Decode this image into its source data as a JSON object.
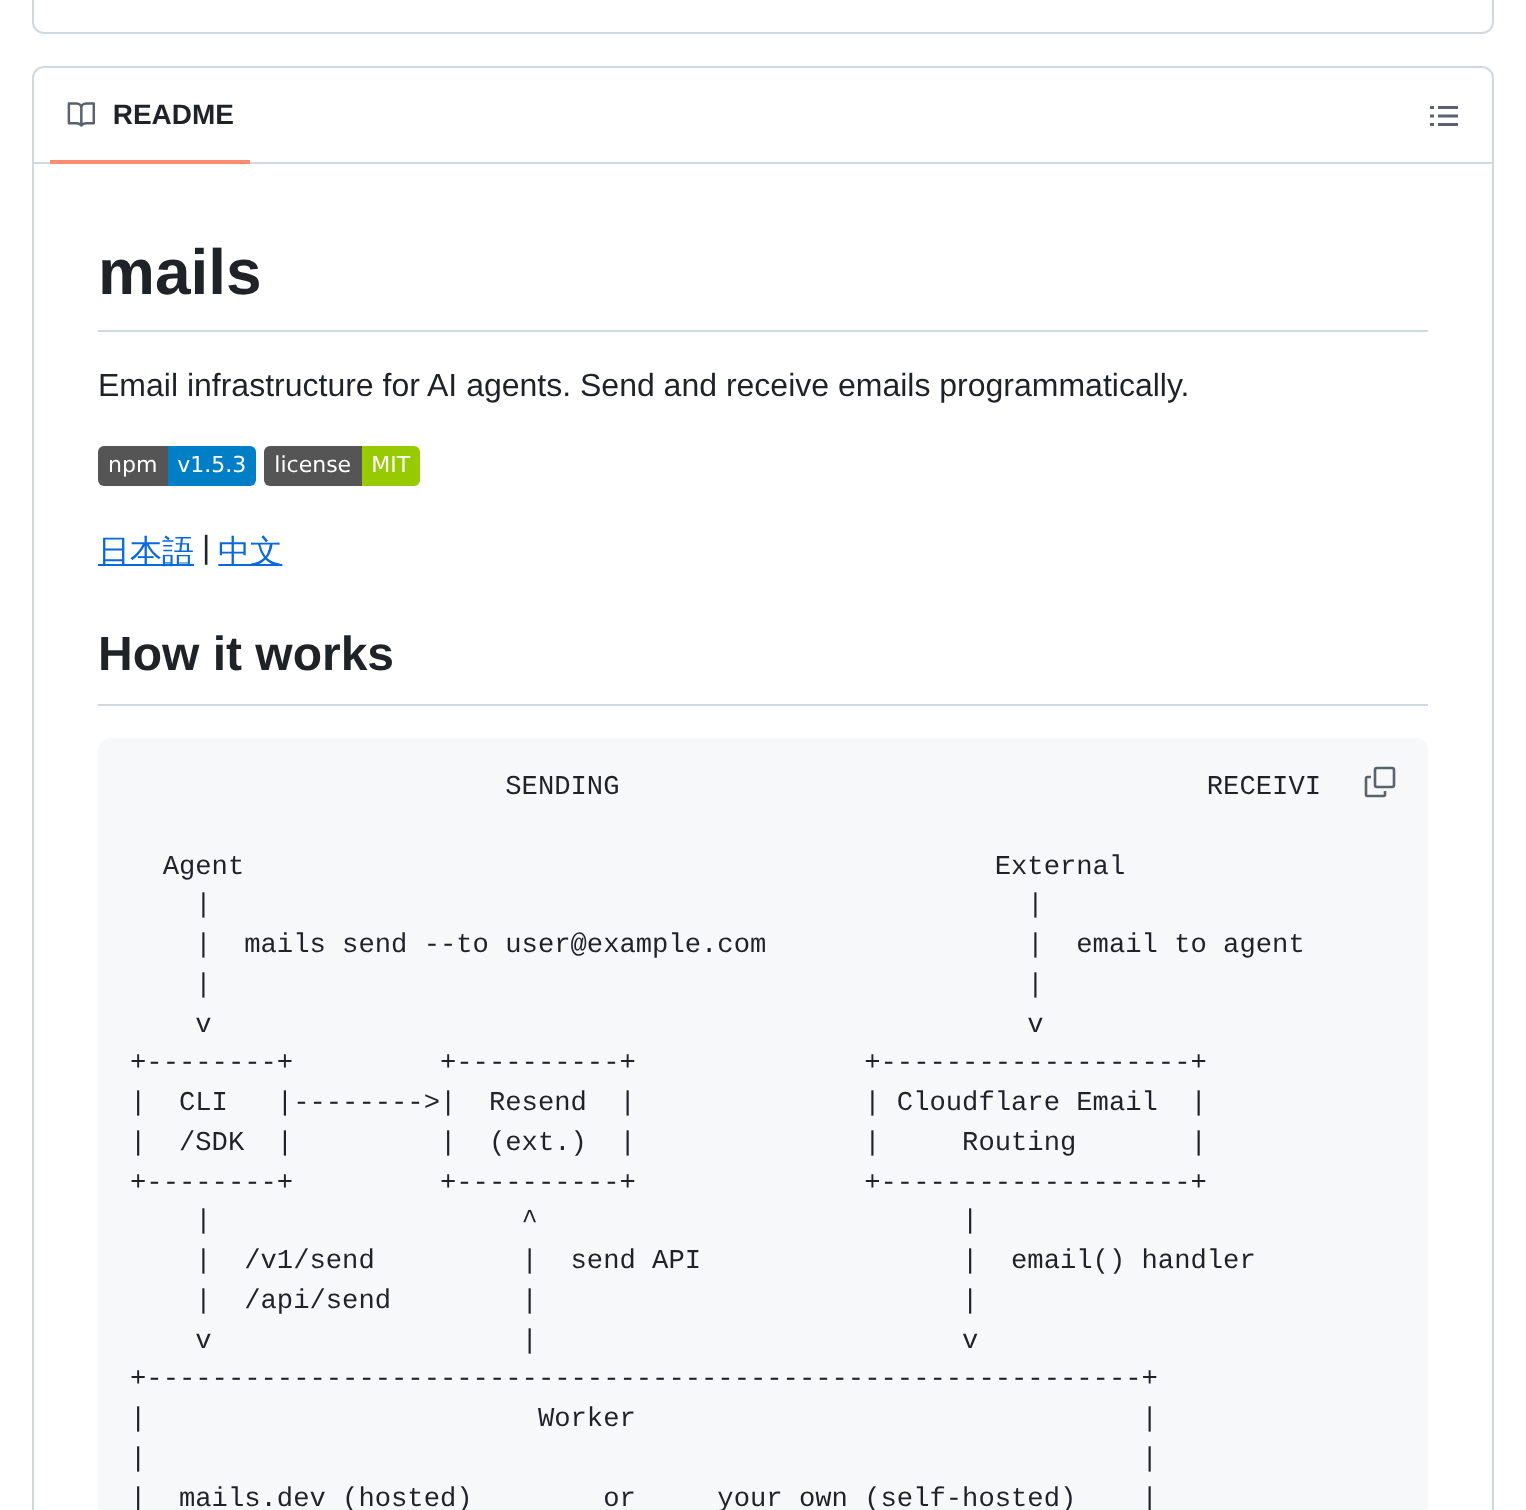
{
  "readme": {
    "tab": {
      "label": "README",
      "selected": true
    },
    "title": "mails",
    "description": "Email infrastructure for AI agents. Send and receive emails programmatically.",
    "badges": [
      {
        "label": "npm",
        "value": "v1.5.3",
        "color": "#007ec6"
      },
      {
        "label": "license",
        "value": "MIT",
        "color": "#97ca00"
      }
    ],
    "languages": [
      {
        "text": "日本語"
      },
      {
        "text": "中文"
      }
    ],
    "language_separator": "|",
    "heading": "How it works",
    "code": "                       SENDING                                    RECEIVI\n\n  Agent                                              External\n    |                                                  |\n    |  mails send --to user@example.com                |  email to agent\n    |                                                  |\n    v                                                  v\n+--------+         +----------+              +-------------------+\n|  CLI   |-------->|  Resend  |              | Cloudflare Email  |\n|  /SDK  |         |  (ext.)  |              |     Routing       |\n+--------+         +----------+              +-------------------+\n    |                   ^                          |\n    |  /v1/send         |  send API                |  email() handler\n    |  /api/send        |                          |\n    v                   |                          v\n+-------------------------------------------------------------+\n|                        Worker                               |\n|                                                             |\n|  mails.dev (hosted)        or     your own (self-hosted)    |"
  }
}
